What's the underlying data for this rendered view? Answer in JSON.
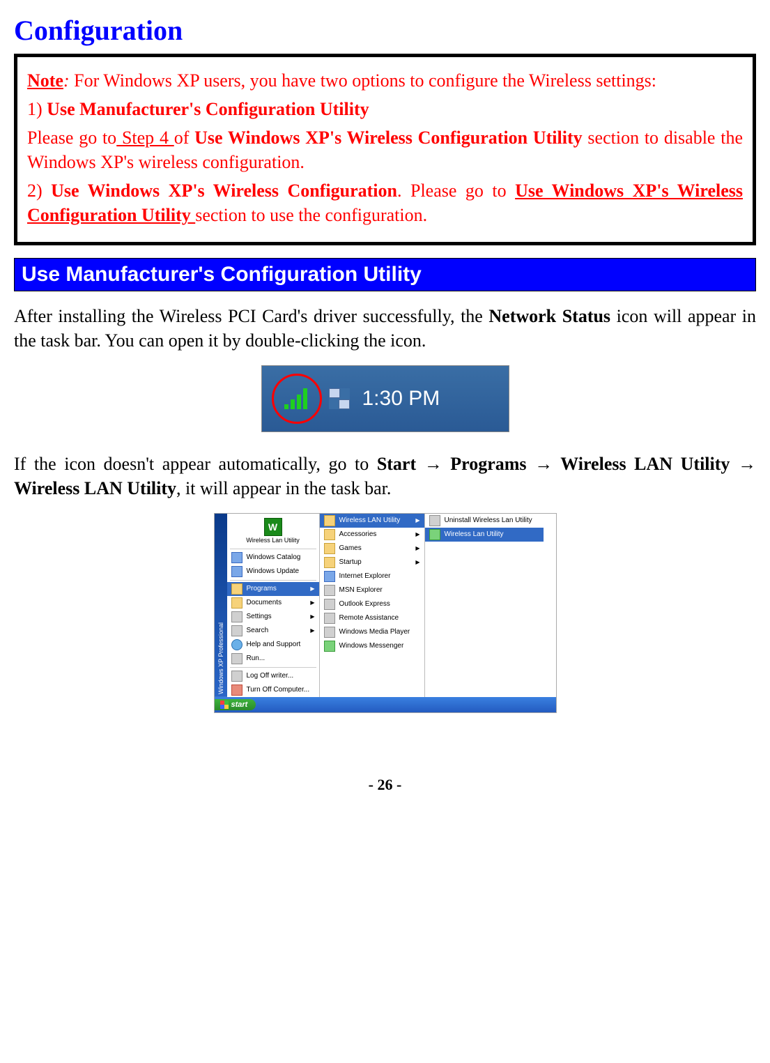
{
  "title": "Configuration",
  "note": {
    "label": "Note",
    "colon": ":",
    "intro_a": " For Windows XP users, you have two options to configure the Wireless settings:",
    "opt1_num": "1) ",
    "opt1_title": "Use Manufacturer's Configuration Utility",
    "opt1_a": "Please go to",
    "opt1_link": " Step 4 ",
    "opt1_b": "of ",
    "opt1_bold": "Use Windows XP's Wireless Configuration Utility",
    "opt1_c": " section to disable the Windows XP's wireless configuration.",
    "opt2_num": "2) ",
    "opt2_title": "Use Windows XP's Wireless Configuration",
    "opt2_a": ". Please go to ",
    "opt2_link": "Use Windows XP's Wireless Configuration Utility ",
    "opt2_b": "section to use the configuration",
    "opt2_dot": "."
  },
  "section_header": "Use Manufacturer's Configuration Utility",
  "para1_a": "After installing the Wireless PCI Card's driver successfully, the ",
  "para1_bold": "Network Status",
  "para1_b": " icon will appear in the task bar. You can open it by double-clicking the icon.",
  "taskbar_clock": "1:30 PM",
  "para2_a": "If the icon doesn't appear automatically, go to ",
  "para2_b1": "Start ",
  "arrow": "→",
  "para2_b2": " Programs ",
  "para2_b3": " Wireless LAN Utility ",
  "para2_b4": " Wireless LAN Utility",
  "para2_c": ", it will appear in the task bar.",
  "startmenu": {
    "sidebar": "Windows XP Professional",
    "header_app": "Wireless Lan Utility",
    "left": [
      "Windows Catalog",
      "Windows Update",
      "Programs",
      "Documents",
      "Settings",
      "Search",
      "Help and Support",
      "Run...",
      "Log Off writer...",
      "Turn Off Computer..."
    ],
    "mid": [
      "Wireless LAN Utility",
      "Accessories",
      "Games",
      "Startup",
      "Internet Explorer",
      "MSN Explorer",
      "Outlook Express",
      "Remote Assistance",
      "Windows Media Player",
      "Windows Messenger"
    ],
    "right": [
      "Uninstall Wireless Lan Utility",
      "Wireless Lan Utility"
    ],
    "start_label": "start"
  },
  "page_number": "- 26 -"
}
